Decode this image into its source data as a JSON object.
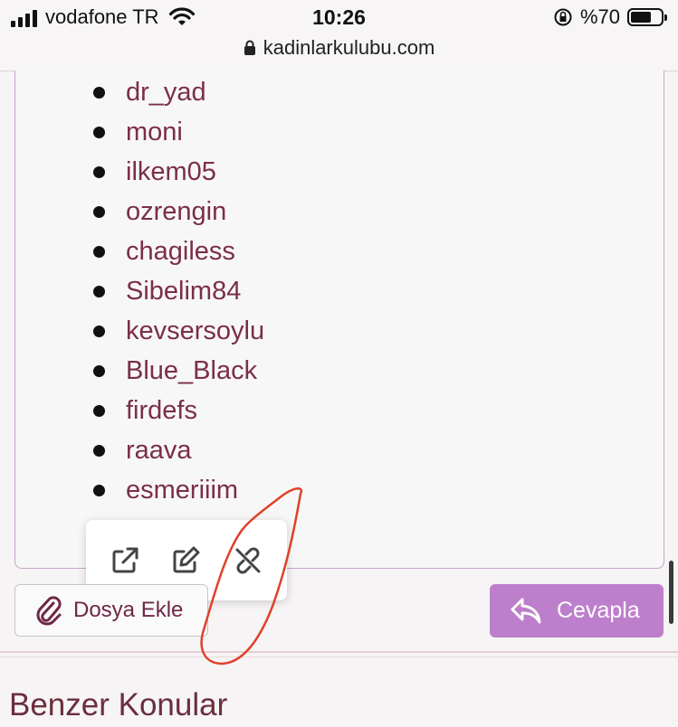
{
  "status_bar": {
    "carrier": "vodafone TR",
    "time": "10:26",
    "battery_percent": "%70",
    "battery_level": 0.7,
    "url": "kadinlarkulubu.com"
  },
  "editor": {
    "user_list": [
      "dr_yad",
      "moni",
      "ilkem05",
      "ozrengin",
      "chagiless",
      "Sibelim84",
      "kevsersoylu",
      "Blue_Black",
      "firdefs",
      "raava",
      "esmeriiim"
    ]
  },
  "link_popup": {
    "icons": [
      "open-link-icon",
      "edit-link-icon",
      "unlink-icon"
    ]
  },
  "actions": {
    "attach_label": "Dosya Ekle",
    "reply_label": "Cevapla"
  },
  "section": {
    "title": "Benzer Konular"
  },
  "colors": {
    "link": "#7a2e4b",
    "accent": "#bd7fcb",
    "annotation": "#e0412a"
  }
}
